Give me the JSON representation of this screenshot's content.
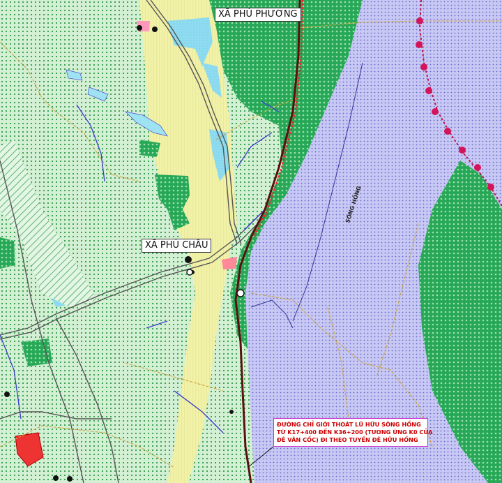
{
  "map": {
    "place_labels": {
      "phu_phuong": "XÃ PHÚ PHƯƠNG",
      "phu_chau": "XÃ PHÚ CHÂU"
    },
    "river_label": "SÔNG HỒNG",
    "flood_line_note": {
      "line1": "ĐƯỜNG CHỈ GIỚI THOÁT LŨ HỮU SÔNG HỒNG",
      "line2": "TỪ K17+400 ĐẾN K36+200 (TƯƠNG ỨNG K0 CỦA",
      "line3": "ĐÊ VÂN CỐC) ĐI THEO TUYẾN ĐÊ HỮU HỒNG"
    },
    "colors": {
      "river_water": "#b8b8ee",
      "riverbank_green": "#2fae5a",
      "agricultural_land": "#cfeecf",
      "settlement_land": "#eeee9a",
      "aquaculture_water": "#9fe3f3",
      "dike_road": "#8b1a1a",
      "boundary_marker": "#d4145a",
      "flood_line_note_border": "#cc33cc",
      "flood_line_note_text": "#cc0000"
    }
  }
}
